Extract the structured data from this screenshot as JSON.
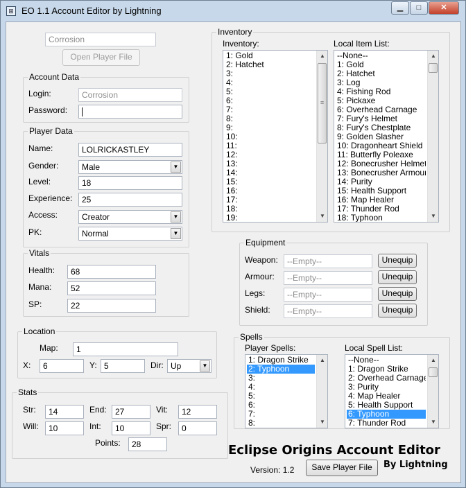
{
  "window": {
    "title": "EO 1.1 Account Editor by Lightning",
    "app_icon_glyph": "⊞",
    "minimize_glyph": "▁",
    "maximize_glyph": "□",
    "close_glyph": "✕"
  },
  "top": {
    "account_name_value": "Corrosion",
    "open_button_label": "Open Player File"
  },
  "account_data": {
    "legend": "Account Data",
    "login_label": "Login:",
    "login_value": "Corrosion",
    "password_label": "Password:",
    "password_value": ""
  },
  "player_data": {
    "legend": "Player Data",
    "name_label": "Name:",
    "name_value": "LOLRICKASTLEY",
    "gender_label": "Gender:",
    "gender_value": "Male",
    "level_label": "Level:",
    "level_value": "18",
    "experience_label": "Experience:",
    "experience_value": "25",
    "access_label": "Access:",
    "access_value": "Creator",
    "pk_label": "PK:",
    "pk_value": "Normal"
  },
  "vitals": {
    "legend": "Vitals",
    "health_label": "Health:",
    "health_value": "68",
    "mana_label": "Mana:",
    "mana_value": "52",
    "sp_label": "SP:",
    "sp_value": "22"
  },
  "location": {
    "legend": "Location",
    "map_label": "Map:",
    "map_value": "1",
    "x_label": "X:",
    "x_value": "6",
    "y_label": "Y:",
    "y_value": "5",
    "dir_label": "Dir:",
    "dir_value": "Up"
  },
  "stats": {
    "legend": "Stats",
    "str_label": "Str:",
    "str_value": "14",
    "end_label": "End:",
    "end_value": "27",
    "vit_label": "Vit:",
    "vit_value": "12",
    "will_label": "Will:",
    "will_value": "10",
    "int_label": "Int:",
    "int_value": "10",
    "spr_label": "Spr:",
    "spr_value": "0",
    "points_label": "Points:",
    "points_value": "28"
  },
  "inventory": {
    "legend": "Inventory",
    "inventory_label": "Inventory:",
    "inventory_items": [
      "1: Gold",
      "2: Hatchet",
      "3:",
      "4:",
      "5:",
      "6:",
      "7:",
      "8:",
      "9:",
      "10:",
      "11:",
      "12:",
      "13:",
      "14:",
      "15:",
      "16:",
      "17:",
      "18:",
      "19:"
    ],
    "local_label": "Local Item List:",
    "local_items": [
      "--None--",
      "1: Gold",
      "2: Hatchet",
      "3: Log",
      "4: Fishing Rod",
      "5: Pickaxe",
      "6: Overhead Carnage",
      "7: Fury's Helmet",
      "8: Fury's Chestplate",
      "9: Golden Slasher",
      "10: Dragonheart Shield",
      "11: Butterfly Poleaxe",
      "12: Bonecrusher Helmet",
      "13: Bonecrusher Armour",
      "14: Purity",
      "15: Health Support",
      "16: Map Healer",
      "17: Thunder Rod",
      "18: Typhoon"
    ]
  },
  "equipment": {
    "legend": "Equipment",
    "weapon_label": "Weapon:",
    "weapon_value": "--Empty--",
    "armour_label": "Armour:",
    "armour_value": "--Empty--",
    "legs_label": "Legs:",
    "legs_value": "--Empty--",
    "shield_label": "Shield:",
    "shield_value": "--Empty--",
    "unequip_label": "Unequip"
  },
  "spells": {
    "legend": "Spells",
    "player_label": "Player Spells:",
    "player_spells": [
      "1: Dragon Strike",
      "2: Typhoon",
      "3:",
      "4:",
      "5:",
      "6:",
      "7:",
      "8:"
    ],
    "player_selected_index": 1,
    "local_label": "Local Spell List:",
    "local_spells": [
      "--None--",
      "1: Dragon Strike",
      "2: Overhead Carnage",
      "3: Purity",
      "4: Map Healer",
      "5: Health Support",
      "6: Typhoon",
      "7: Thunder Rod"
    ],
    "local_selected_index": 6
  },
  "footer": {
    "app_title": "Eclipse Origins Account Editor",
    "by_text": "By Lightning",
    "version_text": "Version: 1.2",
    "save_button_label": "Save Player File"
  },
  "colors": {
    "selection": "#3399ff",
    "window_frame": "#c7d8ea",
    "client_bg": "#f0f0f0"
  }
}
